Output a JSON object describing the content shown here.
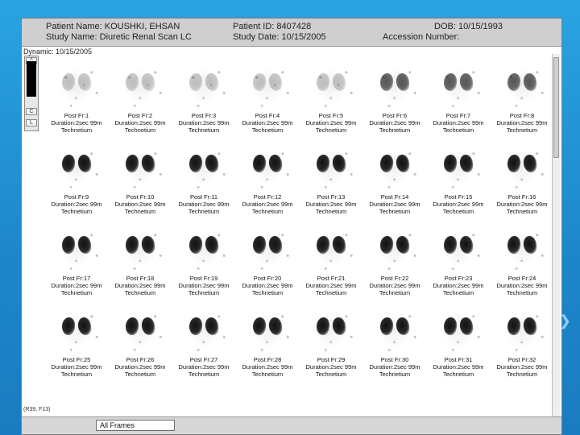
{
  "header": {
    "patient_name": "Patient Name: KOUSHKI, EHSAN",
    "patient_id": "Patient ID: 8407428",
    "dob": "DOB: 10/15/1993",
    "study_name": "Study Name: Diuretic Renal Scan  LC",
    "study_date": "Study Date: 10/15/2005",
    "accession": "Accession Number:"
  },
  "dynamic_label": "Dynamic: 10/15/2005",
  "left_panel": {
    "btn1": "^",
    "btn2": "C",
    "btn3": "L"
  },
  "frames": [
    {
      "title": "Post Fr:1",
      "duration": "Duration:2sec 99m",
      "agent": "Technetium",
      "intensity": "early"
    },
    {
      "title": "Post Fr:2",
      "duration": "Duration:2sec 99m",
      "agent": "Technetium",
      "intensity": "early"
    },
    {
      "title": "Post Fr:3",
      "duration": "Duration:2sec 99m",
      "agent": "Technetium",
      "intensity": "early"
    },
    {
      "title": "Post Fr:4",
      "duration": "Duration:2sec 99m",
      "agent": "Technetium",
      "intensity": "early"
    },
    {
      "title": "Post Fr:5",
      "duration": "Duration:2sec 99m",
      "agent": "Technetium",
      "intensity": "early"
    },
    {
      "title": "Post Fr:6",
      "duration": "Duration:2sec 99m",
      "agent": "Technetium",
      "intensity": "mid"
    },
    {
      "title": "Post Fr:7",
      "duration": "Duration:2sec 99m",
      "agent": "Technetium",
      "intensity": "mid"
    },
    {
      "title": "Post Fr:8",
      "duration": "Duration:2sec 99m",
      "agent": "Technetium",
      "intensity": "mid"
    },
    {
      "title": "Post Fr:9",
      "duration": "Duration:2sec 99m",
      "agent": "Technetium",
      "intensity": "full"
    },
    {
      "title": "Post Fr:10",
      "duration": "Duration:2sec 99m",
      "agent": "Technetium",
      "intensity": "full"
    },
    {
      "title": "Post Fr:11",
      "duration": "Duration:2sec 99m",
      "agent": "Technetium",
      "intensity": "full"
    },
    {
      "title": "Post Fr:12",
      "duration": "Duration:2sec 99m",
      "agent": "Technetium",
      "intensity": "full"
    },
    {
      "title": "Post Fr:13",
      "duration": "Duration:2sec 99m",
      "agent": "Technetium",
      "intensity": "full"
    },
    {
      "title": "Post Fr:14",
      "duration": "Duration:2sec 99m",
      "agent": "Technetium",
      "intensity": "full"
    },
    {
      "title": "Post Fr:15",
      "duration": "Duration:2sec 99m",
      "agent": "Technetium",
      "intensity": "full"
    },
    {
      "title": "Post Fr:16",
      "duration": "Duration:2sec 99m",
      "agent": "Technetium",
      "intensity": "full"
    },
    {
      "title": "Post Fr:17",
      "duration": "Duration:2sec 99m",
      "agent": "Technetium",
      "intensity": "full"
    },
    {
      "title": "Post Fr:18",
      "duration": "Duration:2sec 99m",
      "agent": "Technetium",
      "intensity": "full"
    },
    {
      "title": "Post Fr:19",
      "duration": "Duration:2sec 99m",
      "agent": "Technetium",
      "intensity": "full"
    },
    {
      "title": "Post Fr:20",
      "duration": "Duration:2sec 99m",
      "agent": "Technetium",
      "intensity": "full"
    },
    {
      "title": "Post Fr:21",
      "duration": "Duration:2sec 99m",
      "agent": "Technetium",
      "intensity": "full"
    },
    {
      "title": "Post Fr:22",
      "duration": "Duration:2sec 99m",
      "agent": "Technetium",
      "intensity": "full"
    },
    {
      "title": "Post Fr:23",
      "duration": "Duration:2sec 99m",
      "agent": "Technetium",
      "intensity": "full"
    },
    {
      "title": "Post Fr:24",
      "duration": "Duration:2sec 99m",
      "agent": "Technetium",
      "intensity": "full"
    },
    {
      "title": "Post Fr:25",
      "duration": "Duration:2sec 99m",
      "agent": "Technetium",
      "intensity": "full"
    },
    {
      "title": "Post Fr:26",
      "duration": "Duration:2sec 99m",
      "agent": "Technetium",
      "intensity": "full"
    },
    {
      "title": "Post Fr:27",
      "duration": "Duration:2sec 99m",
      "agent": "Technetium",
      "intensity": "full"
    },
    {
      "title": "Post Fr:28",
      "duration": "Duration:2sec 99m",
      "agent": "Technetium",
      "intensity": "full"
    },
    {
      "title": "Post Fr:29",
      "duration": "Duration:2sec 99m",
      "agent": "Technetium",
      "intensity": "full"
    },
    {
      "title": "Post Fr:30",
      "duration": "Duration:2sec 99m",
      "agent": "Technetium",
      "intensity": "full"
    },
    {
      "title": "Post Fr:31",
      "duration": "Duration:2sec 99m",
      "agent": "Technetium",
      "intensity": "full"
    },
    {
      "title": "Post Fr:32",
      "duration": "Duration:2sec 99m",
      "agent": "Technetium",
      "intensity": "full"
    }
  ],
  "footer_text": "(R39, F13)",
  "status_bar": {
    "frames_select": "All Frames"
  },
  "colors": {
    "slide_bg": "#1f8fd0",
    "header_bg": "#cfcfcf"
  }
}
